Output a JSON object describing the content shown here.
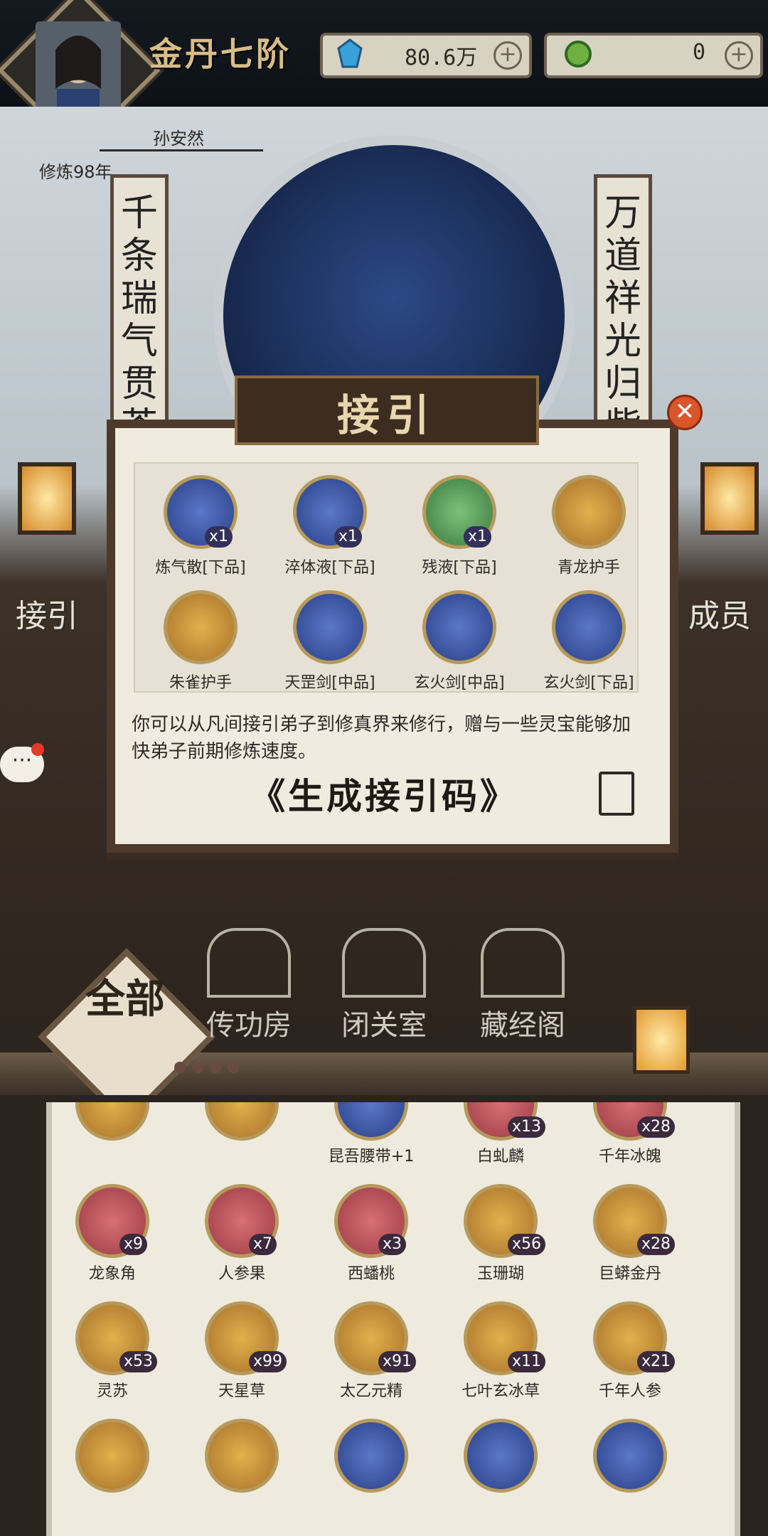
{
  "player": {
    "rank": "金丹七阶",
    "name": "孙安然",
    "cultivation": "修炼98年"
  },
  "resources": [
    {
      "value": "80.6万",
      "icon": "spirit-stone-icon"
    },
    {
      "value": "0",
      "icon": "jade-icon"
    }
  ],
  "couplets": {
    "left": "千条瑞气贯苍",
    "right": "万道祥光归紫"
  },
  "side_buttons": {
    "left": "接引",
    "right": "成员"
  },
  "dialog": {
    "title": "接引",
    "items": [
      {
        "label": "炼气散[下品]",
        "qty": "x1",
        "color": "blue"
      },
      {
        "label": "淬体液[下品]",
        "qty": "x1",
        "color": "blue"
      },
      {
        "label": "残液[下品]",
        "qty": "x1",
        "color": "green"
      },
      {
        "label": "青龙护手",
        "qty": "",
        "color": "gold"
      },
      {
        "label": "朱雀护手",
        "qty": "",
        "color": "gold"
      },
      {
        "label": "天罡剑[中品]",
        "qty": "",
        "color": "blue"
      },
      {
        "label": "玄火剑[中品]",
        "qty": "",
        "color": "blue"
      },
      {
        "label": "玄火剑[下品]",
        "qty": "",
        "color": "blue"
      }
    ],
    "description": "你可以从凡间接引弟子到修真界来修行，赠与一些灵宝能够加快弟子前期修炼速度。",
    "generate_button": "《生成接引码》"
  },
  "nav": {
    "all": "全部",
    "rooms": [
      "传功房",
      "闭关室",
      "藏经阁"
    ]
  },
  "inventory": [
    {
      "label": "",
      "qty": "",
      "color": "gold"
    },
    {
      "label": "",
      "qty": "",
      "color": "gold"
    },
    {
      "label": "昆吾腰带+1",
      "qty": "",
      "color": "blue"
    },
    {
      "label": "白虬麟",
      "qty": "x13",
      "color": "red"
    },
    {
      "label": "千年冰魄",
      "qty": "x28",
      "color": "red"
    },
    {
      "label": "龙象角",
      "qty": "x9",
      "color": "red"
    },
    {
      "label": "人参果",
      "qty": "x7",
      "color": "red"
    },
    {
      "label": "西蟠桃",
      "qty": "x3",
      "color": "red"
    },
    {
      "label": "玉珊瑚",
      "qty": "x56",
      "color": "gold"
    },
    {
      "label": "巨蟒金丹",
      "qty": "x28",
      "color": "gold"
    },
    {
      "label": "灵苏",
      "qty": "x53",
      "color": "gold"
    },
    {
      "label": "天星草",
      "qty": "x99",
      "color": "gold"
    },
    {
      "label": "太乙元精",
      "qty": "x91",
      "color": "gold"
    },
    {
      "label": "七叶玄冰草",
      "qty": "x11",
      "color": "gold"
    },
    {
      "label": "千年人参",
      "qty": "x21",
      "color": "gold"
    },
    {
      "label": "",
      "qty": "",
      "color": "gold"
    },
    {
      "label": "",
      "qty": "",
      "color": "gold"
    },
    {
      "label": "",
      "qty": "",
      "color": "blue"
    },
    {
      "label": "",
      "qty": "",
      "color": "blue"
    },
    {
      "label": "",
      "qty": "",
      "color": "blue"
    }
  ]
}
